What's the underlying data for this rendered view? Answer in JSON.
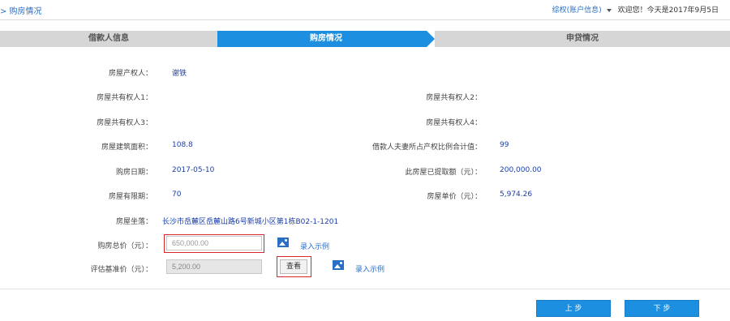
{
  "breadcrumb": "> 购房情况",
  "header": {
    "account": "综权(账户信息)",
    "welcome": "欢迎您！今天是2017年9月5日"
  },
  "steps": [
    "借款人信息",
    "购房情况",
    "申贷情况"
  ],
  "fields": {
    "owner_label": "房屋产权人：",
    "owner_value": "谢铁",
    "co_owner1_label": "房屋共有权人1：",
    "co_owner1_value": "",
    "co_owner2_label": "房屋共有权人2：",
    "co_owner2_value": "",
    "co_owner3_label": "房屋共有权人3：",
    "co_owner3_value": "",
    "co_owner4_label": "房屋共有权人4：",
    "co_owner4_value": "",
    "area_label": "房屋建筑面积：",
    "area_value": "108.8",
    "ratio_label": "借款人夫妻所占产权比例合计值：",
    "ratio_value": "99",
    "purchase_date_label": "购房日期：",
    "purchase_date_value": "2017-05-10",
    "withdrawn_label": "此房屋已提取额（元）：",
    "withdrawn_value": "200,000.00",
    "term_label": "房屋有限期：",
    "term_value": "70",
    "unit_price_label": "房屋单价（元）：",
    "unit_price_value": "5,974.26",
    "address_label": "房屋坐落：",
    "address_value": "长沙市岳麓区岳麓山路6号新城小区第1栋B02-1-1201",
    "total_price_label": "购房总价（元）：",
    "total_price_value": "650,000.00",
    "appraisal_label": "评估基准价（元）：",
    "appraisal_value": "5,200.00"
  },
  "links": {
    "example1": "录入示例",
    "example2": "录入示例"
  },
  "query_button": "查看",
  "buttons": {
    "prev": "上 步",
    "next": "下 步"
  }
}
